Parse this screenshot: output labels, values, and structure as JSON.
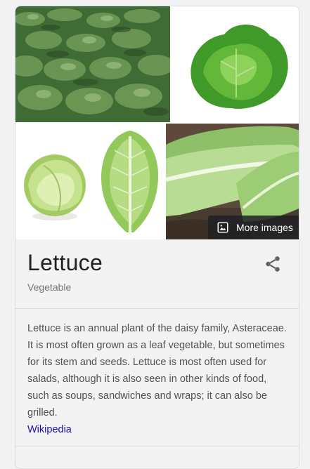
{
  "images": {
    "tiles": [
      {
        "name": "lettuce-field"
      },
      {
        "name": "green-leaf-lettuce"
      },
      {
        "name": "iceberg-lettuce"
      },
      {
        "name": "lettuce-leaf"
      },
      {
        "name": "romaine-lettuce"
      }
    ],
    "more_images_label": "More images",
    "more_images_icon": "image-icon"
  },
  "entity": {
    "title": "Lettuce",
    "subtitle": "Vegetable",
    "share_icon": "share-icon"
  },
  "description": {
    "text": "Lettuce is an annual plant of the daisy family, Asteraceae. It is most often grown as a leaf vegetable, but sometimes for its stem and seeds. Lettuce is most often used for salads, although it is also seen in other kinds of food, such as soups, sandwiches and wraps; it can also be grilled.",
    "source_label": "Wikipedia"
  },
  "colors": {
    "title": "#202124",
    "link": "#1a0dab",
    "muted": "#70757a"
  }
}
